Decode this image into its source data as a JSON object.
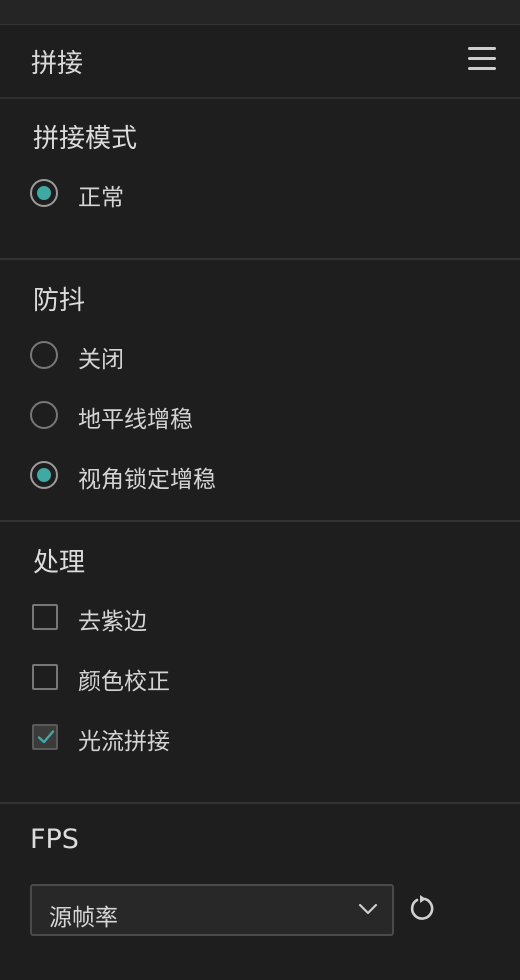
{
  "header": {
    "title": "拼接",
    "menu_icon": "hamburger-menu-icon"
  },
  "stitch_mode": {
    "title": "拼接模式",
    "options": [
      {
        "label": "正常",
        "selected": true
      }
    ]
  },
  "stabilization": {
    "title": "防抖",
    "options": [
      {
        "label": "关闭",
        "selected": false
      },
      {
        "label": "地平线增稳",
        "selected": false
      },
      {
        "label": "视角锁定增稳",
        "selected": true
      }
    ]
  },
  "processing": {
    "title": "处理",
    "options": [
      {
        "label": "去紫边",
        "checked": false
      },
      {
        "label": "颜色校正",
        "checked": false
      },
      {
        "label": "光流拼接",
        "checked": true
      }
    ]
  },
  "fps": {
    "title": "FPS",
    "select_value": "源帧率",
    "dropdown_icon": "chevron-down-icon",
    "reset_icon": "reset-icon"
  },
  "colors": {
    "background": "#1e1e1e",
    "accent": "#3fa9a3",
    "text": "#d4d4d4"
  }
}
